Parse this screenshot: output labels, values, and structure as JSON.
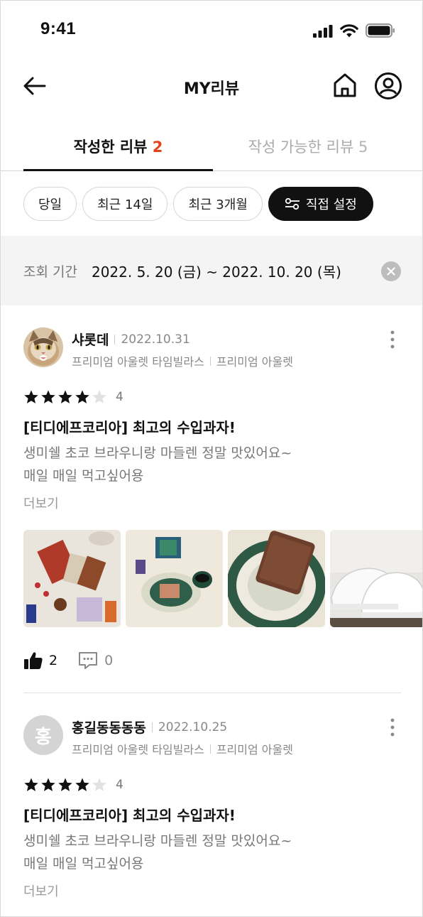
{
  "status_bar": {
    "time": "9:41"
  },
  "header": {
    "title": "MY리뷰"
  },
  "tabs": [
    {
      "label": "작성한 리뷰",
      "count": "2"
    },
    {
      "label": "작성 가능한 리뷰",
      "count": "5"
    }
  ],
  "filters": [
    "당일",
    "최근 14일",
    "최근 3개월",
    "직접 설정"
  ],
  "period": {
    "label": "조회 기간",
    "range": "2022. 5. 20 (금) ~ 2022. 10. 20 (목)"
  },
  "reviews": [
    {
      "author": "샤롯데",
      "date": "2022.10.31",
      "store": "프리미엄 아울렛 타임빌라스",
      "store_type": "프리미엄 아울렛",
      "rating": "4",
      "title": "[티디에프코리아] 최고의 수입과자!",
      "body_line1": "생미쉘 초코 브라우니랑 마들렌 정말 맛있어요~",
      "body_line2": "매일 매일 먹고싶어용",
      "more_label": "더보기",
      "likes": "2",
      "comments": "0"
    },
    {
      "author": "홍길동동동동",
      "avatar_initial": "홍",
      "date": "2022.10.25",
      "store": "프리미엄 아울렛 타임빌라스",
      "store_type": "프리미엄 아울렛",
      "rating": "4",
      "title": "[티디에프코리아] 최고의 수입과자!",
      "body_line1": "생미쉘 초코 브라우니랑 마들렌 정말 맛있어요~",
      "body_line2": "매일 매일 먹고싶어용",
      "more_label": "더보기"
    }
  ],
  "colors": {
    "accent": "#e8401c",
    "dark_chip": "#111111"
  }
}
